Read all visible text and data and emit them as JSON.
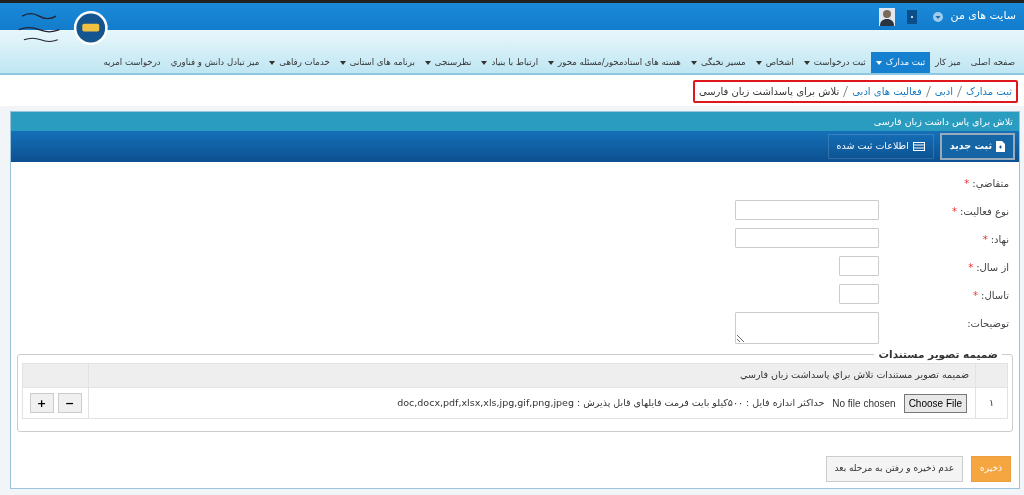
{
  "header": {
    "my_sites": "سایت های من"
  },
  "nav": [
    {
      "label": "صفحه اصلی",
      "dropdown": false,
      "selected": false
    },
    {
      "label": "میز کار",
      "dropdown": false,
      "selected": false
    },
    {
      "label": "ثبت مدارک",
      "dropdown": true,
      "selected": true
    },
    {
      "label": "ثبت درخواست",
      "dropdown": true,
      "selected": false
    },
    {
      "label": "اشخاص",
      "dropdown": true,
      "selected": false
    },
    {
      "label": "مسیر نخبگی",
      "dropdown": true,
      "selected": false
    },
    {
      "label": "هسته های استادمحور/مسئله محور",
      "dropdown": true,
      "selected": false
    },
    {
      "label": "ارتباط با بنیاد",
      "dropdown": true,
      "selected": false
    },
    {
      "label": "نظرسنجی",
      "dropdown": true,
      "selected": false
    },
    {
      "label": "برنامه های استانی",
      "dropdown": true,
      "selected": false
    },
    {
      "label": "خدمات رفاهی",
      "dropdown": true,
      "selected": false
    },
    {
      "label": "میز تبادل دانش و فناوري",
      "dropdown": false,
      "selected": false
    },
    {
      "label": "درخواست امريه",
      "dropdown": false,
      "selected": false
    }
  ],
  "breadcrumb": {
    "highlighted": true,
    "items": [
      "ثبت مدارک",
      "ادبی",
      "فعالیت های ادبی",
      "تلاش برای پاسداشت زبان فارسی"
    ]
  },
  "panel": {
    "title": "تلاش برای پاس داشت زبان فارسی",
    "tabs": [
      {
        "label": "ثبت جدید",
        "kind": "new",
        "selected": true
      },
      {
        "label": "اطلاعات ثبت شده",
        "kind": "list",
        "selected": false
      }
    ],
    "fields": [
      {
        "label": "متقاضي:",
        "required_mark": "*",
        "kind": "none"
      },
      {
        "label": "نوع فعالیت:",
        "required_mark": "*",
        "kind": "long"
      },
      {
        "label": "نهاد:",
        "required_mark": "*",
        "kind": "long"
      },
      {
        "label": "از سال:",
        "required_mark": "*",
        "kind": "short"
      },
      {
        "label": "تاسال:",
        "required_mark": "*",
        "kind": "short"
      },
      {
        "label": "توضیحات:",
        "kind": "textarea"
      }
    ],
    "attachments": {
      "legend": "ضمیمه تصویر مستندات",
      "column_title": "ضمیمه تصویر مستندات تلاش براي پاسداشت زبان فارسي",
      "rows": [
        {
          "number": "۱",
          "choose_button": "Choose File",
          "file_status": "No file chosen",
          "hint": "حداکثر اندازه فایل : ۵۰۰کیلو بایت فرمت فایلهای قابل پذیرش : doc,docx,pdf,xlsx,xls,jpg,gif,png,jpeg"
        }
      ],
      "add_button": "+",
      "remove_button": "−"
    },
    "actions": [
      {
        "label": "ذخیره",
        "kind": "primary"
      },
      {
        "label": "عدم ذخیره و رفتن به مرحله بعد",
        "kind": "secondary"
      }
    ]
  }
}
